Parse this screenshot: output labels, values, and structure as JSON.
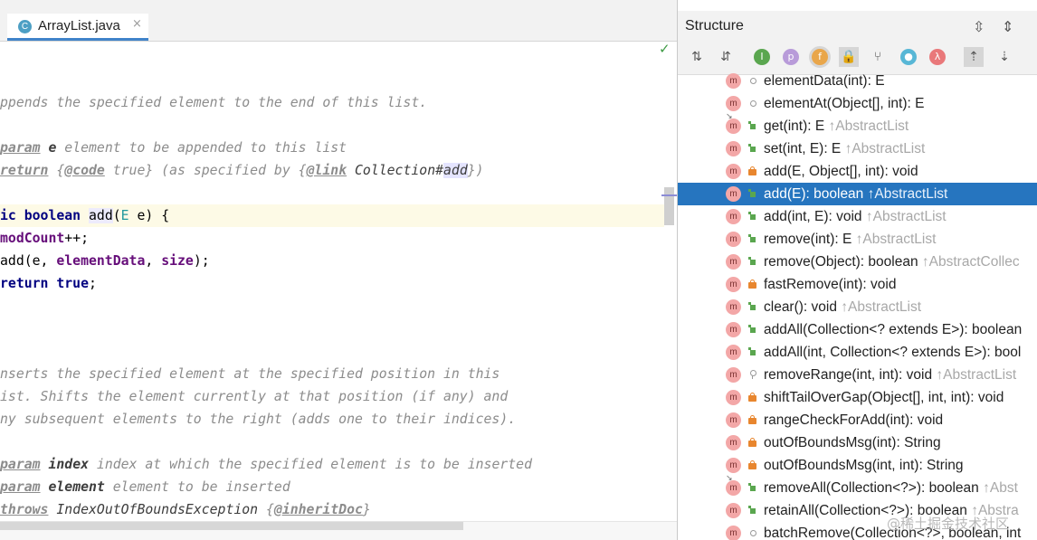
{
  "editor": {
    "tab": {
      "label": "ArrayList.java",
      "icon": "c-class-icon",
      "close": "×"
    },
    "status_check": "✓",
    "lines": [
      {
        "hl": false,
        "tokens": [
          {
            "c": "cmt",
            "t": "ppends the specified element to the end of this list."
          }
        ]
      },
      {
        "hl": false,
        "tokens": []
      },
      {
        "hl": false,
        "tokens": [
          {
            "c": "tag",
            "t": "param"
          },
          {
            "c": "cmt",
            "t": " "
          },
          {
            "c": "pn",
            "t": "e"
          },
          {
            "c": "cmt",
            "t": " element to be appended to this list"
          }
        ]
      },
      {
        "hl": false,
        "tokens": [
          {
            "c": "tag",
            "t": "return"
          },
          {
            "c": "cmt",
            "t": " {"
          },
          {
            "c": "tag",
            "t": "@code"
          },
          {
            "c": "cmt",
            "t": " true} (as specified by {"
          },
          {
            "c": "tag",
            "t": "@link"
          },
          {
            "c": "cmt",
            "t": " "
          },
          {
            "c": "ref",
            "t": "Collection#"
          },
          {
            "c": "refhl",
            "t": "add"
          },
          {
            "c": "cmt",
            "t": "})"
          }
        ]
      },
      {
        "hl": false,
        "tokens": []
      },
      {
        "hl": true,
        "tokens": [
          {
            "c": "kw",
            "t": "ic boolean "
          },
          {
            "c": "addsel",
            "t": "add"
          },
          {
            "c": "",
            "t": "("
          },
          {
            "c": "tp",
            "t": "E"
          },
          {
            "c": "",
            "t": " e) {"
          }
        ]
      },
      {
        "hl": false,
        "tokens": [
          {
            "c": "fld",
            "t": "modCount"
          },
          {
            "c": "",
            "t": "++;"
          }
        ]
      },
      {
        "hl": false,
        "tokens": [
          {
            "c": "",
            "t": "add(e, "
          },
          {
            "c": "fld",
            "t": "elementData"
          },
          {
            "c": "",
            "t": ", "
          },
          {
            "c": "fld",
            "t": "size"
          },
          {
            "c": "",
            "t": ");"
          }
        ]
      },
      {
        "hl": false,
        "tokens": [
          {
            "c": "kw",
            "t": "return true"
          },
          {
            "c": "",
            "t": ";"
          }
        ]
      },
      {
        "hl": false,
        "tokens": []
      },
      {
        "hl": false,
        "tokens": []
      },
      {
        "hl": false,
        "tokens": []
      },
      {
        "hl": false,
        "tokens": [
          {
            "c": "cmt",
            "t": "nserts the specified element at the specified position in this"
          }
        ]
      },
      {
        "hl": false,
        "tokens": [
          {
            "c": "cmt",
            "t": "ist. Shifts the element currently at that position (if any) and"
          }
        ]
      },
      {
        "hl": false,
        "tokens": [
          {
            "c": "cmt",
            "t": "ny subsequent elements to the right (adds one to their indices)."
          }
        ]
      },
      {
        "hl": false,
        "tokens": []
      },
      {
        "hl": false,
        "tokens": [
          {
            "c": "tag",
            "t": "param"
          },
          {
            "c": "cmt",
            "t": " "
          },
          {
            "c": "pn",
            "t": "index"
          },
          {
            "c": "cmt",
            "t": " index at which the specified element is to be inserted"
          }
        ]
      },
      {
        "hl": false,
        "tokens": [
          {
            "c": "tag",
            "t": "param"
          },
          {
            "c": "cmt",
            "t": " "
          },
          {
            "c": "pn",
            "t": "element"
          },
          {
            "c": "cmt",
            "t": " element to be inserted"
          }
        ]
      },
      {
        "hl": false,
        "tokens": [
          {
            "c": "tag",
            "t": "throws"
          },
          {
            "c": "cmt",
            "t": " "
          },
          {
            "c": "ref",
            "t": "IndexOutOfBoundsException"
          },
          {
            "c": "cmt",
            "t": " {"
          },
          {
            "c": "tag",
            "t": "@inheritDoc"
          },
          {
            "c": "cmt",
            "t": "}"
          }
        ]
      }
    ]
  },
  "structure": {
    "title": "Structure",
    "toolbar": [
      {
        "name": "sort-by-visibility-icon",
        "glyph": "⇅",
        "style": "plain"
      },
      {
        "name": "sort-alphabetically-icon",
        "glyph": "⇵",
        "style": "plain"
      },
      {
        "name": "show-inherited-icon",
        "glyph": "I",
        "style": "circle",
        "color": "#5aa64f"
      },
      {
        "name": "show-properties-icon",
        "glyph": "p",
        "style": "circle",
        "color": "#b89bd9"
      },
      {
        "name": "show-fields-icon",
        "glyph": "f",
        "style": "circle-active",
        "color": "#e9a64a"
      },
      {
        "name": "show-non-public-icon",
        "glyph": "🔒",
        "style": "active"
      },
      {
        "name": "show-lambdas-icon",
        "glyph": "⑂",
        "style": "plain"
      },
      {
        "name": "show-anonymous-icon",
        "glyph": "●",
        "style": "circle",
        "color": "#58b7d6"
      },
      {
        "name": "show-lambda-icon",
        "glyph": "λ",
        "style": "circle",
        "color": "#e9787a"
      },
      {
        "name": "autoscroll-to-source-icon",
        "glyph": "⇡",
        "style": "active"
      },
      {
        "name": "autoscroll-from-source-icon",
        "glyph": "⇣",
        "style": "plain"
      }
    ],
    "members": [
      {
        "vis": "pkg",
        "name": "elementData(int): E",
        "inherited": "",
        "pin": false,
        "selected": false
      },
      {
        "vis": "pkg",
        "name": "elementAt(Object[], int): E",
        "inherited": "",
        "pin": true,
        "selected": false
      },
      {
        "vis": "pub",
        "name": "get(int): E",
        "inherited": "↑AbstractList",
        "pin": false,
        "selected": false
      },
      {
        "vis": "pub",
        "name": "set(int, E): E",
        "inherited": "↑AbstractList",
        "pin": false,
        "selected": false
      },
      {
        "vis": "priv",
        "name": "add(E, Object[], int): void",
        "inherited": "",
        "pin": false,
        "selected": false
      },
      {
        "vis": "pub",
        "name": "add(E): boolean",
        "inherited": "↑AbstractList",
        "pin": false,
        "selected": true
      },
      {
        "vis": "pub",
        "name": "add(int, E): void",
        "inherited": "↑AbstractList",
        "pin": false,
        "selected": false
      },
      {
        "vis": "pub",
        "name": "remove(int): E",
        "inherited": "↑AbstractList",
        "pin": false,
        "selected": false
      },
      {
        "vis": "pub",
        "name": "remove(Object): boolean",
        "inherited": "↑AbstractCollec",
        "pin": false,
        "selected": false
      },
      {
        "vis": "priv",
        "name": "fastRemove(int): void",
        "inherited": "",
        "pin": false,
        "selected": false
      },
      {
        "vis": "pub",
        "name": "clear(): void",
        "inherited": "↑AbstractList",
        "pin": false,
        "selected": false
      },
      {
        "vis": "pub",
        "name": "addAll(Collection<? extends E>): boolean",
        "inherited": "",
        "pin": false,
        "selected": false
      },
      {
        "vis": "pub",
        "name": "addAll(int, Collection<? extends E>): bool",
        "inherited": "",
        "pin": false,
        "selected": false
      },
      {
        "vis": "prot",
        "name": "removeRange(int, int): void",
        "inherited": "↑AbstractList",
        "pin": false,
        "selected": false
      },
      {
        "vis": "priv",
        "name": "shiftTailOverGap(Object[], int, int): void",
        "inherited": "",
        "pin": false,
        "selected": false
      },
      {
        "vis": "priv",
        "name": "rangeCheckForAdd(int): void",
        "inherited": "",
        "pin": false,
        "selected": false
      },
      {
        "vis": "priv",
        "name": "outOfBoundsMsg(int): String",
        "inherited": "",
        "pin": false,
        "selected": false
      },
      {
        "vis": "priv",
        "name": "outOfBoundsMsg(int, int): String",
        "inherited": "",
        "pin": true,
        "selected": false
      },
      {
        "vis": "pub",
        "name": "removeAll(Collection<?>): boolean",
        "inherited": "↑Abst",
        "pin": false,
        "selected": false
      },
      {
        "vis": "pub",
        "name": "retainAll(Collection<?>): boolean",
        "inherited": "↑Abstra",
        "pin": false,
        "selected": false
      },
      {
        "vis": "pkg",
        "name": "batchRemove(Collection<?>, boolean, int",
        "inherited": "",
        "pin": false,
        "selected": false
      }
    ]
  },
  "watermark": "@稀土掘金技术社区"
}
